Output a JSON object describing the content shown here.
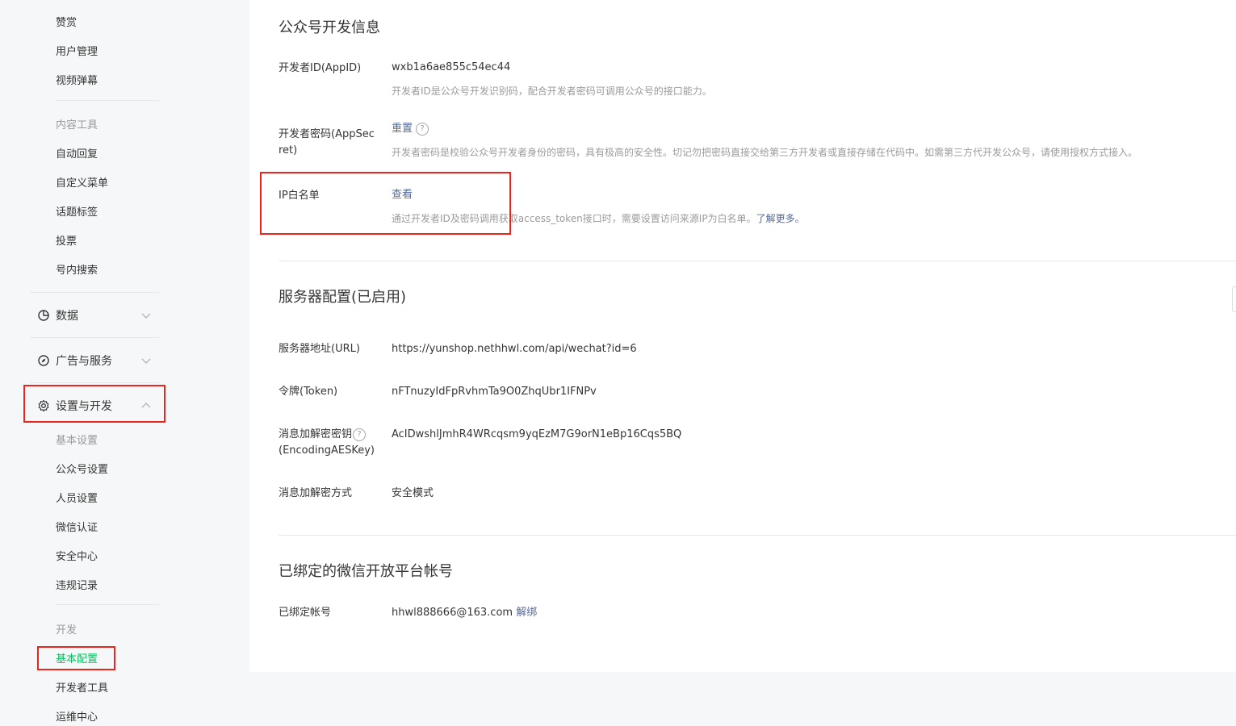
{
  "sidebar": {
    "top_items": [
      "赞赏",
      "用户管理",
      "视频弹幕"
    ],
    "content_tools": {
      "group_label": "内容工具",
      "items": [
        "自动回复",
        "自定义菜单",
        "话题标签",
        "投票",
        "号内搜索"
      ]
    },
    "sections": {
      "data": "数据",
      "ads": "广告与服务",
      "settings": "设置与开发"
    },
    "basic_settings": {
      "group_label": "基本设置",
      "items": [
        "公众号设置",
        "人员设置",
        "微信认证",
        "安全中心",
        "违规记录"
      ]
    },
    "dev": {
      "group_label": "开发",
      "items": [
        "基本配置",
        "开发者工具",
        "运维中心"
      ]
    },
    "colors": {
      "active": "#07c160",
      "highlight_box": "#e8261e"
    }
  },
  "dev_info": {
    "title": "公众号开发信息",
    "appid_label": "开发者ID(AppID)",
    "appid_value": "wxb1a6ae855c54ec44",
    "appid_desc": "开发者ID是公众号开发识别码，配合开发者密码可调用公众号的接口能力。",
    "secret_label_1": "开发者密码(AppSec",
    "secret_label_2": "ret)",
    "secret_action": "重置",
    "help_glyph": "?",
    "secret_desc": "开发者密码是校验公众号开发者身份的密码，具有极高的安全性。切记勿把密码直接交给第三方开发者或直接存储在代码中。如需第三方代开发公众号，请使用授权方式接入。",
    "ip_label": "IP白名单",
    "ip_action": "查看",
    "ip_desc": "通过开发者ID及密码调用获取access_token接口时，需要设置访问来源IP为白名单。",
    "ip_learn_more": "了解更多。"
  },
  "server_config": {
    "title": "服务器配置(已启用)",
    "url_label": "服务器地址(URL)",
    "url_value": "https://yunshop.nethhwl.com/api/wechat?id=6",
    "token_label": "令牌(Token)",
    "token_value": "nFTnuzyIdFpRvhmTa9O0ZhqUbr1IFNPv",
    "aes_label_1": "消息加解密密钥",
    "aes_label_2": "(EncodingAESKey)",
    "aes_value": "AcIDwshlJmhR4WRcqsm9yqEzM7G9orN1eBp16Cqs5BQ",
    "mode_label": "消息加解密方式",
    "mode_value": "安全模式"
  },
  "bound_account": {
    "title": "已绑定的微信开放平台帐号",
    "label": "已绑定帐号",
    "value": "hhwl888666@163.com",
    "unbind": "解绑"
  }
}
